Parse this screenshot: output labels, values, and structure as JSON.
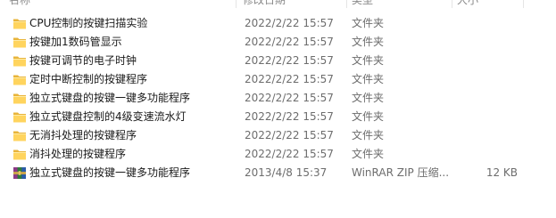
{
  "columns": {
    "name": "名称",
    "date": "修改日期",
    "type": "类型",
    "size": "大小"
  },
  "files": [
    {
      "name": "CPU控制的按键扫描实验",
      "date": "2022/2/22 15:57",
      "type": "文件夹",
      "size": "",
      "icon": "folder-icon"
    },
    {
      "name": "按键加1数码管显示",
      "date": "2022/2/22 15:57",
      "type": "文件夹",
      "size": "",
      "icon": "folder-icon"
    },
    {
      "name": "按键可调节的电子时钟",
      "date": "2022/2/22 15:57",
      "type": "文件夹",
      "size": "",
      "icon": "folder-icon"
    },
    {
      "name": "定时中断控制的按键程序",
      "date": "2022/2/22 15:57",
      "type": "文件夹",
      "size": "",
      "icon": "folder-icon"
    },
    {
      "name": "独立式键盘的按键一键多功能程序",
      "date": "2022/2/22 15:57",
      "type": "文件夹",
      "size": "",
      "icon": "folder-icon"
    },
    {
      "name": "独立式键盘控制的4级变速流水灯",
      "date": "2022/2/22 15:57",
      "type": "文件夹",
      "size": "",
      "icon": "folder-icon"
    },
    {
      "name": "无消抖处理的按键程序",
      "date": "2022/2/22 15:57",
      "type": "文件夹",
      "size": "",
      "icon": "folder-icon"
    },
    {
      "name": "消抖处理的按键程序",
      "date": "2022/2/22 15:57",
      "type": "文件夹",
      "size": "",
      "icon": "folder-icon"
    },
    {
      "name": "独立式键盘的按键一键多功能程序",
      "date": "2013/4/8 15:37",
      "type": "WinRAR ZIP 压缩...",
      "size": "12 KB",
      "icon": "winrar-archive-icon"
    }
  ],
  "colors": {
    "folder_body": "#ffd45e",
    "folder_back": "#e8b43a"
  }
}
